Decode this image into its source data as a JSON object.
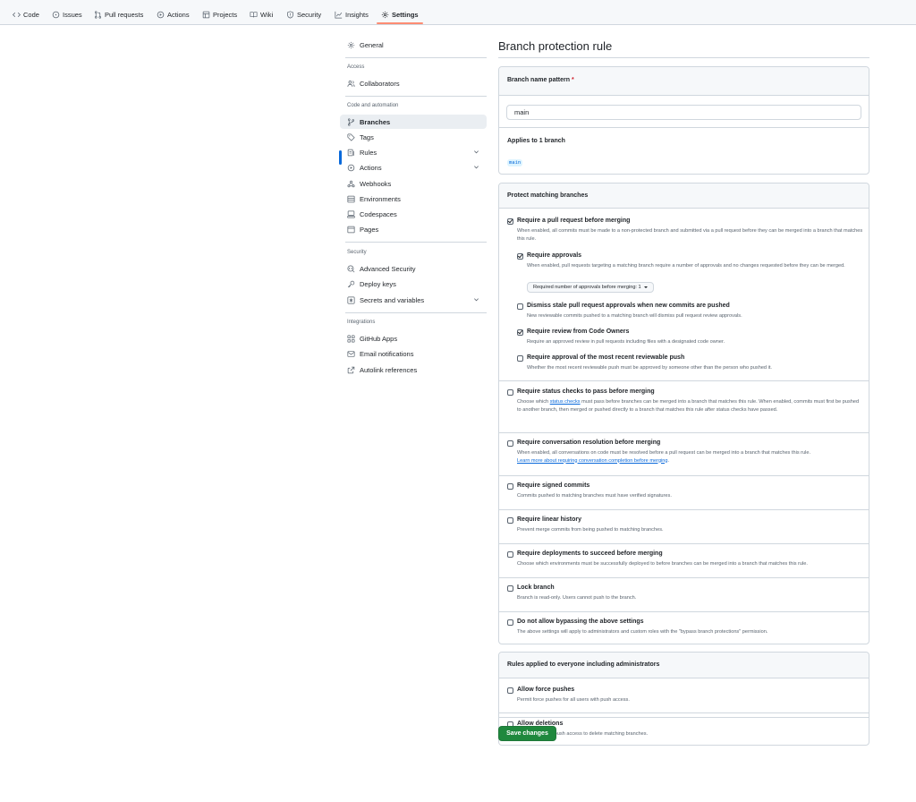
{
  "repo_nav": {
    "tabs": [
      {
        "label": "Code",
        "icon": "code-icon"
      },
      {
        "label": "Issues",
        "icon": "issue-icon"
      },
      {
        "label": "Pull requests",
        "icon": "pull-request-icon"
      },
      {
        "label": "Actions",
        "icon": "play-icon"
      },
      {
        "label": "Projects",
        "icon": "table-icon"
      },
      {
        "label": "Wiki",
        "icon": "book-icon"
      },
      {
        "label": "Security",
        "icon": "shield-icon"
      },
      {
        "label": "Insights",
        "icon": "graph-icon"
      },
      {
        "label": "Settings",
        "icon": "gear-icon",
        "selected": true
      }
    ]
  },
  "sidebar": {
    "general": "General",
    "sections": {
      "access": "Access",
      "code_automation": "Code and automation",
      "security": "Security",
      "integrations": "Integrations"
    },
    "items": {
      "collaborators": "Collaborators",
      "branches": "Branches",
      "tags": "Tags",
      "rules": "Rules",
      "actions": "Actions",
      "webhooks": "Webhooks",
      "environments": "Environments",
      "codespaces": "Codespaces",
      "pages": "Pages",
      "advanced_security": "Advanced Security",
      "deploy_keys": "Deploy keys",
      "secrets_variables": "Secrets and variables",
      "github_apps": "GitHub Apps",
      "email_notifications": "Email notifications",
      "autolink_references": "Autolink references"
    }
  },
  "main": {
    "title": "Branch protection rule",
    "pattern_box": {
      "label": "Branch name pattern",
      "required_marker": "*",
      "value": "main",
      "applies_to": "Applies to 1 branch",
      "matched_branch": "main"
    },
    "protect_box": {
      "heading": "Protect matching branches",
      "require_pr": {
        "title": "Require a pull request before merging",
        "desc": "When enabled, all commits must be made to a non-protected branch and submitted via a pull request before they can be merged into a branch that matches this rule.",
        "checked": true
      },
      "require_approvals": {
        "title": "Require approvals",
        "desc": "When enabled, pull requests targeting a matching branch require a number of approvals and no changes requested before they can be merged.",
        "checked": true,
        "select_label": "Required number of approvals before merging: 1"
      },
      "dismiss_stale": {
        "title": "Dismiss stale pull request approvals when new commits are pushed",
        "desc": "New reviewable commits pushed to a matching branch will dismiss pull request review approvals.",
        "checked": false
      },
      "code_owners": {
        "title": "Require review from Code Owners",
        "desc": "Require an approved review in pull requests including files with a designated code owner.",
        "checked": true
      },
      "recent_push": {
        "title": "Require approval of the most recent reviewable push",
        "desc": "Whether the most recent reviewable push must be approved by someone other than the person who pushed it.",
        "checked": false
      },
      "status_checks": {
        "title": "Require status checks to pass before merging",
        "desc_pre": "Choose which ",
        "desc_link": "status checks",
        "desc_post": " must pass before branches can be merged into a branch that matches this rule. When enabled, commits must first be pushed to another branch, then merged or pushed directly to a branch that matches this rule after status checks have passed.",
        "checked": false
      },
      "conversation": {
        "title": "Require conversation resolution before merging",
        "desc": "When enabled, all conversations on code must be resolved before a pull request can be merged into a branch that matches this rule.",
        "link": "Learn more about requiring conversation completion before merging",
        "link_suffix": ".",
        "checked": false
      },
      "signed_commits": {
        "title": "Require signed commits",
        "desc": "Commits pushed to matching branches must have verified signatures.",
        "checked": false
      },
      "linear_history": {
        "title": "Require linear history",
        "desc": "Prevent merge commits from being pushed to matching branches.",
        "checked": false
      },
      "deployments": {
        "title": "Require deployments to succeed before merging",
        "desc": "Choose which environments must be successfully deployed to before branches can be merged into a branch that matches this rule.",
        "checked": false
      },
      "lock_branch": {
        "title": "Lock branch",
        "desc": "Branch is read-only. Users cannot push to the branch.",
        "checked": false
      },
      "no_bypass": {
        "title": "Do not allow bypassing the above settings",
        "desc": "The above settings will apply to administrators and custom roles with the \"bypass branch protections\" permission.",
        "checked": false
      }
    },
    "everyone_box": {
      "heading": "Rules applied to everyone including administrators",
      "force_pushes": {
        "title": "Allow force pushes",
        "desc": "Permit force pushes for all users with push access.",
        "checked": false
      },
      "deletions": {
        "title": "Allow deletions",
        "desc": "Allow users with push access to delete matching branches.",
        "checked": false
      }
    },
    "save_label": "Save changes"
  },
  "colors": {
    "accent": "#0969da",
    "save_green": "#1f883d",
    "selected_underline": "#fd8c73",
    "required": "#cf222e"
  }
}
